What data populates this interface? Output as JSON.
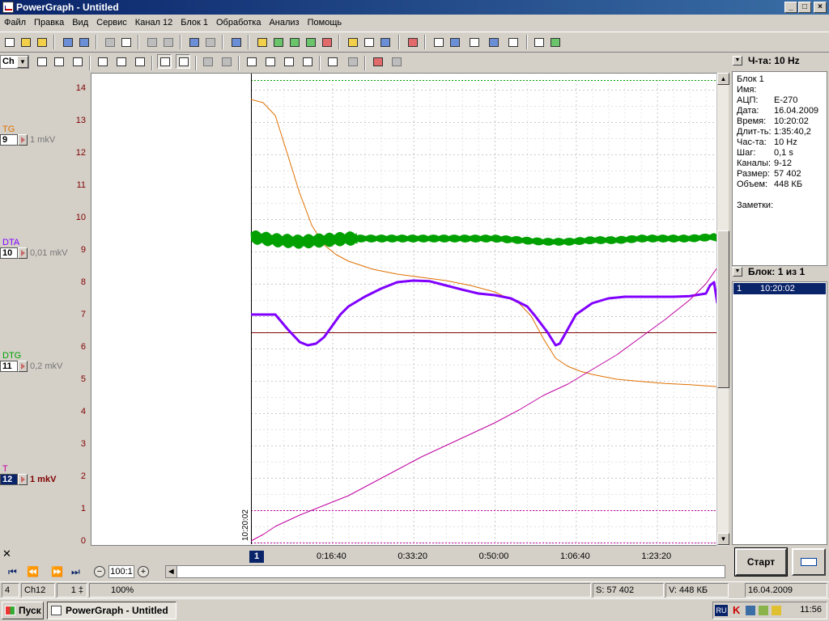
{
  "window": {
    "title": "PowerGraph - Untitled"
  },
  "menu": [
    "Файл",
    "Правка",
    "Вид",
    "Сервис",
    "Канал 12",
    "Блок 1",
    "Обработка",
    "Анализ",
    "Помощь"
  ],
  "toolbar": {
    "channel_select": "Ch"
  },
  "channels": [
    {
      "name": "TG",
      "number": "9",
      "unit": "1 mkV",
      "color": "#e07000"
    },
    {
      "name": "DTA",
      "number": "10",
      "unit": "0,01 mkV",
      "color": "#8000ff"
    },
    {
      "name": "DTG",
      "number": "11",
      "unit": "0,2 mkV",
      "color": "#00a000"
    },
    {
      "name": "T",
      "number": "12",
      "unit": "1 mkV",
      "color": "#c000a0"
    }
  ],
  "chart_data": {
    "type": "line",
    "y_ticks": [
      "14",
      "13",
      "12",
      "11",
      "10",
      "9",
      "8",
      "7",
      "6",
      "5",
      "4",
      "3",
      "2",
      "1",
      "0"
    ],
    "ylim": [
      0,
      14.4
    ],
    "x_start_label": "10:20:02",
    "x_tick_labels": [
      "0:16:40",
      "0:33:20",
      "0:50:00",
      "1:06:40",
      "1:23:20"
    ],
    "x_tick_seconds": [
      1000,
      2000,
      3000,
      4000,
      5000
    ],
    "xlim_seconds": [
      0,
      5740
    ],
    "reference_lines": [
      {
        "y": 14.3,
        "color": "#00a000"
      },
      {
        "y": 6.5,
        "color": "#800000"
      },
      {
        "y": 1.0,
        "color": "#c000a0"
      },
      {
        "y": 0.0,
        "color": "#c000a0"
      }
    ],
    "series": [
      {
        "name": "TG",
        "color": "#e07000",
        "x": [
          0,
          150,
          300,
          450,
          600,
          750,
          900,
          1050,
          1200,
          1500,
          1800,
          2100,
          2400,
          2700,
          3000,
          3300,
          3450,
          3600,
          3750,
          3900,
          4050,
          4200,
          4500,
          4800,
          5100,
          5400,
          5740
        ],
        "y": [
          13.7,
          13.6,
          13.2,
          12.0,
          10.8,
          9.8,
          9.2,
          8.9,
          8.7,
          8.45,
          8.3,
          8.2,
          8.1,
          7.95,
          7.75,
          7.4,
          7.0,
          6.3,
          5.7,
          5.45,
          5.3,
          5.2,
          5.05,
          4.98,
          4.92,
          4.88,
          4.82
        ]
      },
      {
        "name": "DTA",
        "color": "#8000ff",
        "x": [
          0,
          300,
          450,
          600,
          700,
          800,
          900,
          1100,
          1200,
          1400,
          1600,
          1800,
          2000,
          2200,
          2400,
          2600,
          2800,
          3000,
          3200,
          3400,
          3500,
          3650,
          3750,
          3800,
          3900,
          4000,
          4200,
          4400,
          4600,
          4800,
          5000,
          5200,
          5400,
          5600,
          5650,
          5700,
          5740
        ],
        "y": [
          7.05,
          7.05,
          6.6,
          6.2,
          6.1,
          6.15,
          6.35,
          7.05,
          7.3,
          7.6,
          7.85,
          8.05,
          8.1,
          8.08,
          7.95,
          7.82,
          7.7,
          7.65,
          7.55,
          7.3,
          7.0,
          6.5,
          6.1,
          6.15,
          6.6,
          7.05,
          7.4,
          7.55,
          7.6,
          7.6,
          7.6,
          7.6,
          7.62,
          7.7,
          7.95,
          8.05,
          7.4
        ]
      },
      {
        "name": "DTG",
        "color": "#00a000",
        "x": [
          0,
          300,
          600,
          900,
          1200,
          1500,
          1800,
          2100,
          2400,
          2700,
          3000,
          3300,
          3600,
          3900,
          4200,
          4500,
          4800,
          5100,
          5400,
          5700,
          5740
        ],
        "y": [
          9.45,
          9.35,
          9.3,
          9.35,
          9.4,
          9.4,
          9.4,
          9.4,
          9.4,
          9.4,
          9.4,
          9.35,
          9.3,
          9.3,
          9.35,
          9.35,
          9.4,
          9.4,
          9.4,
          9.45,
          9.4
        ]
      },
      {
        "name": "T",
        "color": "#c000a0",
        "x": [
          0,
          150,
          300,
          600,
          900,
          1200,
          1500,
          1800,
          2100,
          2400,
          2700,
          3000,
          3300,
          3600,
          3900,
          4200,
          4500,
          4800,
          5100,
          5400,
          5600,
          5740
        ],
        "y": [
          0.05,
          0.25,
          0.5,
          0.85,
          1.15,
          1.45,
          1.85,
          2.25,
          2.65,
          3.0,
          3.35,
          3.7,
          4.1,
          4.55,
          4.9,
          5.35,
          5.8,
          6.35,
          6.9,
          7.5,
          8.0,
          8.5
        ]
      }
    ]
  },
  "x_axis": {
    "block_number": "1"
  },
  "zoom": {
    "value": "100:1"
  },
  "right_panel": {
    "freq_header": "Ч-та: 10 Hz",
    "block_title": "Блок 1",
    "info": [
      {
        "k": "Имя:",
        "v": ""
      },
      {
        "k": "АЦП:",
        "v": "E-270"
      },
      {
        "k": "Дата:",
        "v": "16.04.2009"
      },
      {
        "k": "Время:",
        "v": "10:20:02"
      },
      {
        "k": "Длит-ть:",
        "v": "1:35:40,2"
      },
      {
        "k": "Час-та:",
        "v": "10 Hz"
      },
      {
        "k": "Шаг:",
        "v": "0,1 s"
      },
      {
        "k": "Каналы:",
        "v": "9-12"
      },
      {
        "k": "Размер:",
        "v": "57 402"
      },
      {
        "k": "Объем:",
        "v": "448 КБ"
      }
    ],
    "notes_label": "Заметки:",
    "blocks_header": "Блок: 1 из 1",
    "block_row": {
      "num": "1",
      "time": "10:20:02"
    },
    "start_button": "Старт"
  },
  "status": {
    "s1": "4",
    "s2": "Ch12",
    "s3": "1 ‡",
    "s4": "100%",
    "s5": "S: 57 402",
    "s6": "V: 448 КБ",
    "s7": "16.04.2009"
  },
  "taskbar": {
    "start": "Пуск",
    "task": "PowerGraph - Untitled",
    "lang": "RU",
    "clock": "11:56"
  }
}
